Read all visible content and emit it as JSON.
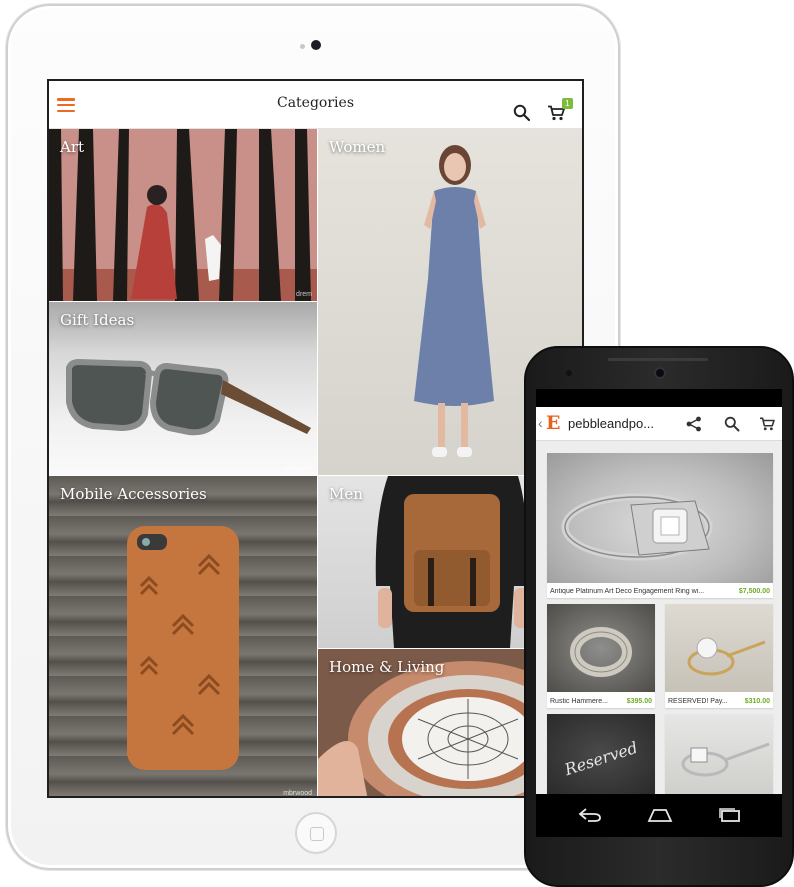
{
  "tablet": {
    "app_bar": {
      "title": "Categories",
      "cart_count": "1"
    },
    "categories": [
      {
        "label": "Art",
        "credit": "drem"
      },
      {
        "label": "Women",
        "credit": ""
      },
      {
        "label": "Gift Ideas",
        "credit": "mbrwood"
      },
      {
        "label": "Mobile Accessories",
        "credit": "mbrwood"
      },
      {
        "label": "Men",
        "credit": "ar"
      },
      {
        "label": "Home & Living",
        "credit": ""
      }
    ],
    "icons": [
      "menu-icon",
      "search-icon",
      "cart-icon"
    ]
  },
  "phone": {
    "app_bar": {
      "logo": "E",
      "back": "‹",
      "shop_name": "pebbleandpo..."
    },
    "listings": [
      {
        "name": "Antique Platinum Art Deco Engagement Ring wi...",
        "price": "$7,500.00"
      },
      {
        "name": "Rustic Hammere...",
        "price": "$395.00"
      },
      {
        "name": "RESERVED! Pay...",
        "price": "$310.00"
      },
      {
        "name": "",
        "price": "",
        "image_text": "Reserved"
      },
      {
        "name": "",
        "price": ""
      }
    ],
    "icons": [
      "share-icon",
      "search-icon",
      "cart-icon",
      "back-nav-icon",
      "home-nav-icon",
      "recents-nav-icon"
    ]
  },
  "colors": {
    "accent": "#ee6a22",
    "price": "#6eab2a",
    "badge": "#7dbb3b"
  }
}
